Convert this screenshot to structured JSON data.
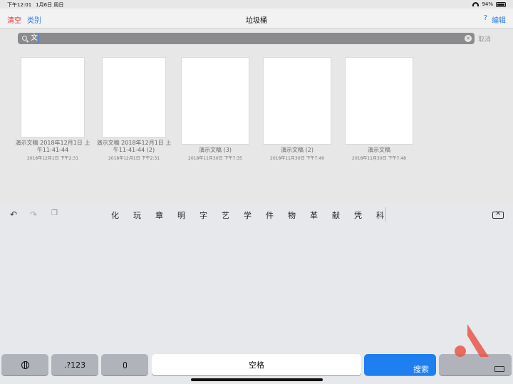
{
  "status": {
    "time": "下午12:01",
    "date": "1月6日 周日",
    "battery": "94%"
  },
  "nav": {
    "clear": "清空",
    "category": "类别",
    "title": "垃圾桶",
    "help": "?",
    "edit": "编辑"
  },
  "search": {
    "value": "文",
    "cancel": "取消"
  },
  "docs": [
    {
      "name": "演示文稿 2018年12月1日 上午11-41-44",
      "date": "2018年12月1日 下午2:31"
    },
    {
      "name": "演示文稿 2018年12月1日 上午11-41-44 (2)",
      "date": "2018年12月1日 下午2:31"
    },
    {
      "name": "演示文稿 (3)",
      "date": "2018年11月30日 下午7:35"
    },
    {
      "name": "演示文稿 (2)",
      "date": "2018年11月30日 下午7:49"
    },
    {
      "name": "演示文稿",
      "date": "2018年11月30日 下午7:48"
    }
  ],
  "keyboard": {
    "candidates": [
      "化",
      "玩",
      "章",
      "明",
      "字",
      "艺",
      "学",
      "件",
      "物",
      "革",
      "献",
      "凭",
      "科"
    ],
    "num_key": ".?123",
    "space": "空格",
    "search": "搜索"
  }
}
